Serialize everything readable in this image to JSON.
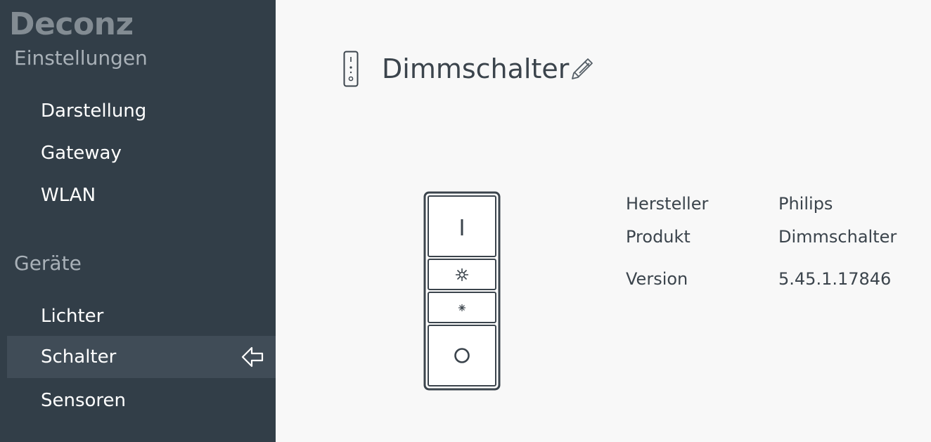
{
  "sidebar": {
    "brand": "Deconz",
    "settings_title": "Einstellungen",
    "settings_items": [
      {
        "label": "Darstellung"
      },
      {
        "label": "Gateway"
      },
      {
        "label": "WLAN"
      }
    ],
    "devices_title": "Geräte",
    "device_items": [
      {
        "label": "Lichter"
      },
      {
        "label": "Schalter"
      },
      {
        "label": "Sensoren"
      }
    ],
    "active_item": "Schalter",
    "active_indicator_icon": "arrow-left-icon"
  },
  "main": {
    "device_icon": "remote-switch-icon",
    "title": "Dimmschalter",
    "edit_icon": "pencil-icon",
    "switch_buttons": [
      {
        "glyph": "I"
      },
      {
        "glyph": "✳"
      },
      {
        "glyph": "✳"
      },
      {
        "glyph": "O"
      }
    ],
    "info": [
      {
        "key": "Hersteller",
        "value": "Philips"
      },
      {
        "key": "Produkt",
        "value": "Dimmschalter"
      },
      {
        "key": "Version",
        "value": "5.45.1.17846"
      }
    ]
  },
  "colors": {
    "sidebar_bg": "#323e48",
    "sidebar_active_bg": "#404c57",
    "main_bg": "#f8f8f8",
    "text_dark": "#3b444c"
  }
}
